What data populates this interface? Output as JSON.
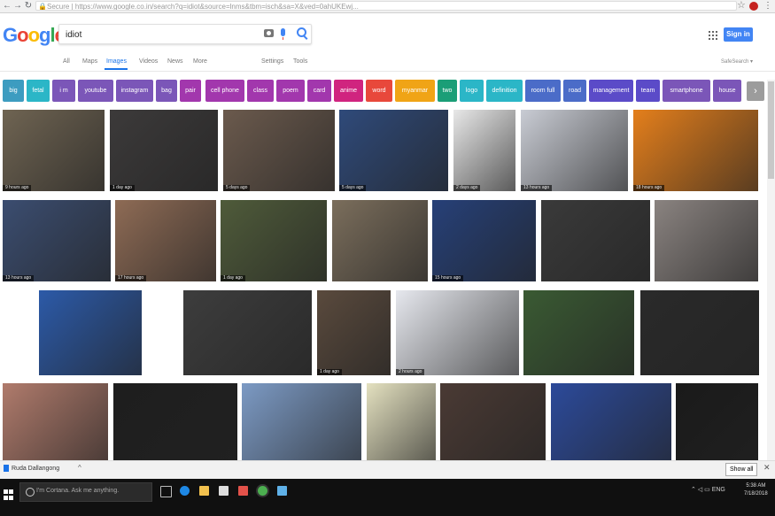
{
  "browser": {
    "url": "Secure | https://www.google.co.in/search?q=idiot&source=lnms&tbm=isch&sa=X&ved=0ahUKEwj..."
  },
  "google": {
    "logo": [
      "G",
      "o",
      "o",
      "g",
      "l",
      "e"
    ],
    "query": "idiot",
    "signin_label": "Sign in",
    "tabs": [
      "All",
      "Maps",
      "Images",
      "Videos",
      "News",
      "More"
    ],
    "tools": [
      "Settings",
      "Tools"
    ],
    "safesearch": "SafeSearch ▾"
  },
  "chips": [
    {
      "label": "big",
      "color": "#3d9cc0"
    },
    {
      "label": "fetal",
      "color": "#2bb6c7"
    },
    {
      "label": "i m",
      "color": "#7b56b8"
    },
    {
      "label": "youtube",
      "color": "#7b56b8"
    },
    {
      "label": "instagram",
      "color": "#7b56b8"
    },
    {
      "label": "bag",
      "color": "#7b56b8"
    },
    {
      "label": "pair",
      "color": "#a237ad"
    },
    {
      "label": "cell phone",
      "color": "#a237ad"
    },
    {
      "label": "class",
      "color": "#a237ad"
    },
    {
      "label": "poem",
      "color": "#a237ad"
    },
    {
      "label": "card",
      "color": "#a237ad"
    },
    {
      "label": "anime",
      "color": "#d0247f"
    },
    {
      "label": "word",
      "color": "#e8483b"
    },
    {
      "label": "myanmar",
      "color": "#f0a416"
    },
    {
      "label": "two",
      "color": "#1b9e77"
    },
    {
      "label": "logo",
      "color": "#2bb6c7"
    },
    {
      "label": "definition",
      "color": "#2bb6c7"
    },
    {
      "label": "room full",
      "color": "#4b6cc8"
    },
    {
      "label": "road",
      "color": "#4b6cc8"
    },
    {
      "label": "management",
      "color": "#5b4bc8"
    },
    {
      "label": "team",
      "color": "#5b4bc8"
    },
    {
      "label": "smartphone",
      "color": "#7b56b8"
    },
    {
      "label": "house",
      "color": "#7b56b8"
    }
  ],
  "chip_next": "›",
  "images": [
    {
      "caption": "9 hours ago",
      "bg": "#6f6452"
    },
    {
      "caption": "1 day ago",
      "bg": "#3c3a3a"
    },
    {
      "caption": "5 days ago",
      "bg": "#6b5a4d"
    },
    {
      "caption": "5 days ago",
      "bg": "#2f4a7a"
    },
    {
      "caption": "2 days ago",
      "bg": "#e8e8e8"
    },
    {
      "caption": "13 hours ago",
      "bg": "#c9ccd4"
    },
    {
      "caption": "18 hours ago",
      "bg": "#e47f1c"
    },
    {
      "caption": "13 hours ago",
      "bg": "#3b4d70"
    },
    {
      "caption": "17 hours ago",
      "bg": "#8e6b55"
    },
    {
      "caption": "1 day ago",
      "bg": "#4f5b3a"
    },
    {
      "caption": "",
      "bg": "#7b6e5c"
    },
    {
      "caption": "15 hours ago",
      "bg": "#264078"
    },
    {
      "caption": "",
      "bg": "#3a3a3a"
    },
    {
      "caption": "",
      "bg": "#8a8380"
    },
    {
      "caption": "",
      "bg": "#2c5aa8"
    },
    {
      "caption": "",
      "bg": "#3d3d3d"
    },
    {
      "caption": "1 day ago",
      "bg": "#5a4a3d"
    },
    {
      "caption": "2 hours ago",
      "bg": "#e6e8ee"
    },
    {
      "caption": "",
      "bg": "#3a5a33"
    },
    {
      "caption": "",
      "bg": "#2a2a2a"
    },
    {
      "caption": "",
      "bg": "#b07b6c"
    },
    {
      "caption": "",
      "bg": "#1e1e1e"
    },
    {
      "caption": "",
      "bg": "#7c9ac4"
    },
    {
      "caption": "",
      "bg": "#e4e1c0"
    },
    {
      "caption": "",
      "bg": "#4a3a34"
    },
    {
      "caption": "",
      "bg": "#2c4a9a"
    },
    {
      "caption": "",
      "bg": "#1a1a1a"
    }
  ],
  "download": {
    "file": "Ruda Dallangong",
    "show_all": "Show all"
  },
  "taskbar": {
    "search_placeholder": "I'm Cortana. Ask me anything.",
    "tray": "⌃ ◁ ▭ ENG",
    "time": "5:38 AM",
    "date": "7/18/2018"
  }
}
